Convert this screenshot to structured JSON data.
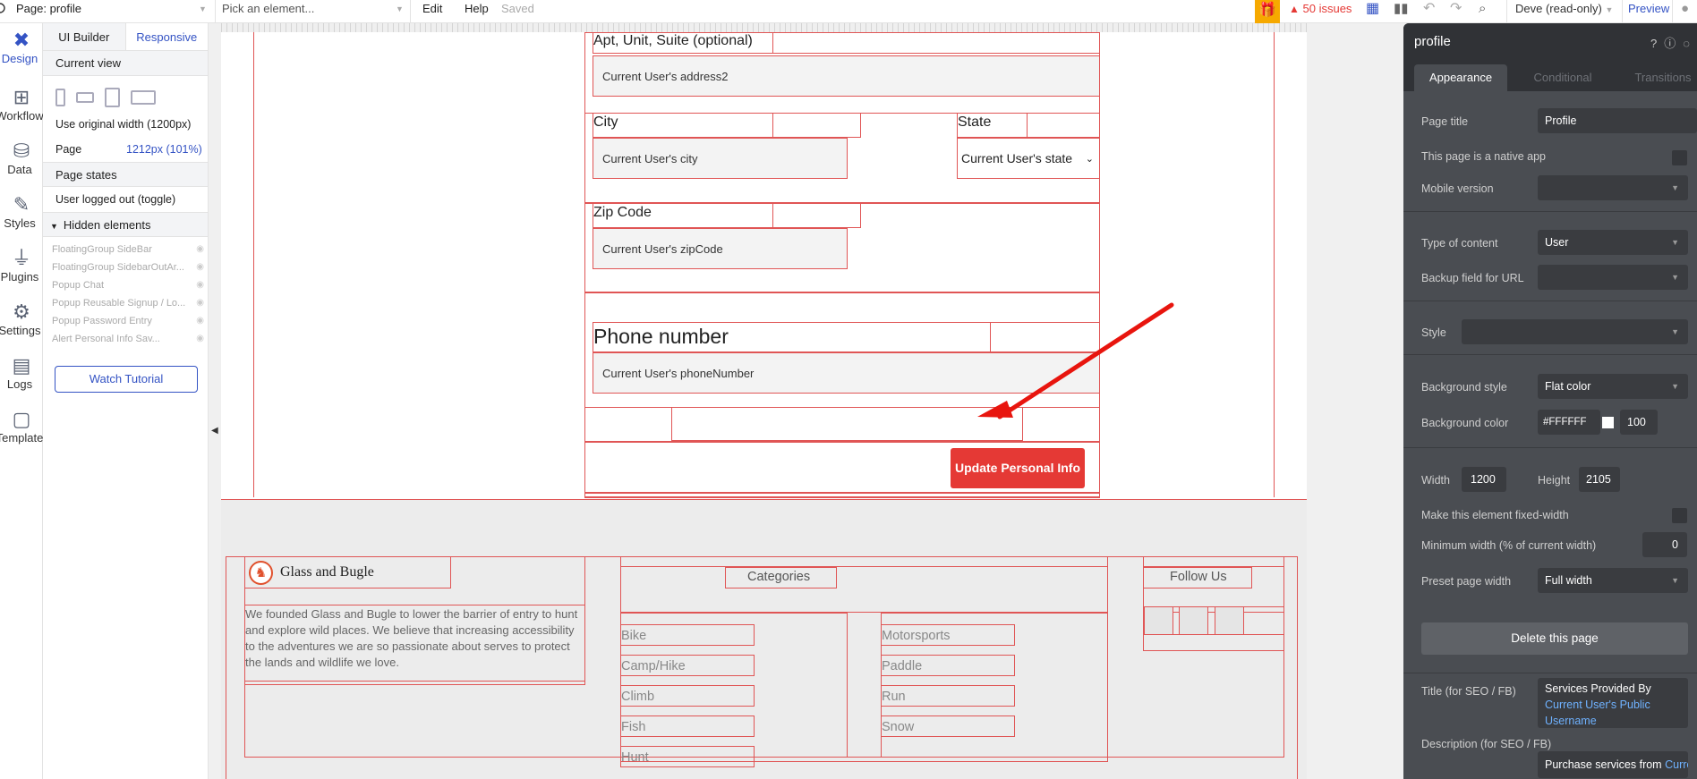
{
  "topbar": {
    "page_selector": "Page: profile",
    "element_picker": "Pick an element...",
    "menu_edit": "Edit",
    "menu_help": "Help",
    "saved": "Saved",
    "issues": "50 issues",
    "version": "Deve (read-only)",
    "preview": "Preview"
  },
  "iconcol": {
    "items": [
      {
        "label": "Design",
        "icon": "design-icon"
      },
      {
        "label": "Workflow",
        "icon": "workflow-icon"
      },
      {
        "label": "Data",
        "icon": "database-icon"
      },
      {
        "label": "Styles",
        "icon": "brush-icon"
      },
      {
        "label": "Plugins",
        "icon": "plug-icon"
      },
      {
        "label": "Settings",
        "icon": "gear-icon"
      },
      {
        "label": "Logs",
        "icon": "document-icon"
      },
      {
        "label": "Template",
        "icon": "template-icon"
      }
    ]
  },
  "leftpanel": {
    "tab_ui_builder": "UI Builder",
    "tab_responsive": "Responsive",
    "current_view": "Current view",
    "use_original_width": "Use original width (1200px)",
    "page_label": "Page",
    "page_value": "1212px (101%)",
    "page_states": "Page states",
    "state_1": "User logged out (toggle)",
    "hidden_elements": "Hidden elements",
    "hidden_list": [
      "FloatingGroup SideBar",
      "FloatingGroup SidebarOutAr...",
      "Popup Chat",
      "Popup Reusable Signup / Lo...",
      "Popup Password Entry",
      "Alert Personal Info Sav..."
    ],
    "watch_tutorial": "Watch Tutorial"
  },
  "canvas": {
    "apt_label": "Apt, Unit, Suite (optional)",
    "address2_value": "Current User's address2",
    "city_label": "City",
    "city_value": "Current User's city",
    "state_label": "State",
    "state_value": "Current User's state",
    "zip_label": "Zip Code",
    "zip_value": "Current User's zipCode",
    "phone_label": "Phone number",
    "phone_value": "Current User's phoneNumber",
    "update_button": "Update Personal Info",
    "annotation_arrow_color": "#e8150e"
  },
  "footer": {
    "brand": "Glass and Bugle",
    "about": "We founded Glass and Bugle to lower the barrier of entry to hunt and explore wild places. We believe that increasing accessibility to the adventures we are so passionate about serves to protect the lands and wildlife we love.",
    "categories_title": "Categories",
    "categories_left": [
      "Bike",
      "Camp/Hike",
      "Climb",
      "Fish",
      "Hunt"
    ],
    "categories_right": [
      "Motorsports",
      "Paddle",
      "Run",
      "Snow"
    ],
    "follow_us": "Follow Us"
  },
  "rightpanel": {
    "title": "profile",
    "tab_appearance": "Appearance",
    "tab_conditional": "Conditional",
    "tab_transitions": "Transitions",
    "page_title_label": "Page title",
    "page_title_value": "Profile",
    "native_app_label": "This page is a native app",
    "mobile_version_label": "Mobile version",
    "type_of_content_label": "Type of content",
    "type_of_content_value": "User",
    "backup_field_label": "Backup field for URL",
    "style_label": "Style",
    "bg_style_label": "Background style",
    "bg_style_value": "Flat color",
    "bg_color_label": "Background color",
    "bg_color_value": "#FFFFFF",
    "bg_opacity": "100",
    "width_label": "Width",
    "width_value": "1200",
    "height_label": "Height",
    "height_value": "2105",
    "fixed_width_label": "Make this element fixed-width",
    "min_width_label": "Minimum width (% of current width)",
    "min_width_value": "0",
    "preset_width_label": "Preset page width",
    "preset_width_value": "Full width",
    "delete_page": "Delete this page",
    "seo_title_label": "Title (for SEO / FB)",
    "seo_title_text": "Services Provided By",
    "seo_title_dynamic": "Current User's Public Username",
    "seo_desc_label": "Description (for SEO / FB)",
    "seo_desc_text": "Purchase services from",
    "seo_desc_dynamic": "Current User's Public"
  }
}
